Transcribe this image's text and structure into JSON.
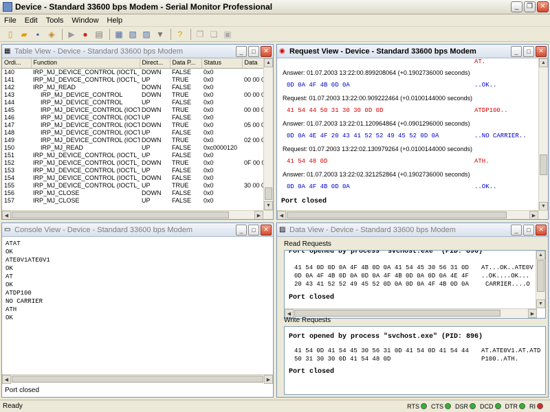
{
  "window": {
    "title": "Device - Standard 33600 bps Modem - Serial Monitor Professional"
  },
  "menu": [
    "File",
    "Edit",
    "Tools",
    "Window",
    "Help"
  ],
  "table_view": {
    "title": "Table View - Device - Standard 33600 bps Modem",
    "columns": [
      "Ordi...",
      "Function",
      "Direct...",
      "Data P...",
      "Status",
      "Data"
    ],
    "rows": [
      [
        "140",
        "IRP_MJ_DEVICE_CONTROL (IOCTL_...",
        "DOWN",
        "FALSE",
        "0x0",
        ""
      ],
      [
        "141",
        "IRP_MJ_DEVICE_CONTROL (IOCTL_...",
        "UP",
        "TRUE",
        "0x0",
        "00 00 0"
      ],
      [
        "142",
        "IRP_MJ_READ",
        "DOWN",
        "FALSE",
        "0x0",
        ""
      ],
      [
        "143",
        "IRP_MJ_DEVICE_CONTROL",
        "DOWN",
        "TRUE",
        "0x0",
        "00 00 0"
      ],
      [
        "144",
        "IRP_MJ_DEVICE_CONTROL",
        "UP",
        "FALSE",
        "0x0",
        ""
      ],
      [
        "145",
        "IRP_MJ_DEVICE_CONTROL (IOCT...",
        "DOWN",
        "TRUE",
        "0x0",
        "00 00 0"
      ],
      [
        "146",
        "IRP_MJ_DEVICE_CONTROL (IOCTL_...",
        "UP",
        "FALSE",
        "0x0",
        ""
      ],
      [
        "147",
        "IRP_MJ_DEVICE_CONTROL (IOCT...",
        "DOWN",
        "TRUE",
        "0x0",
        "05 00 0"
      ],
      [
        "148",
        "IRP_MJ_DEVICE_CONTROL (IOCTL_...",
        "UP",
        "FALSE",
        "0x0",
        ""
      ],
      [
        "149",
        "IRP_MJ_DEVICE_CONTROL (IOCT...",
        "DOWN",
        "TRUE",
        "0x0",
        "02 00 0"
      ],
      [
        "150",
        "IRP_MJ_READ",
        "UP",
        "FALSE",
        "0xc0000120",
        ""
      ],
      [
        "151",
        "IRP_MJ_DEVICE_CONTROL (IOCTL_...",
        "UP",
        "FALSE",
        "0x0",
        ""
      ],
      [
        "152",
        "IRP_MJ_DEVICE_CONTROL (IOCTL_...",
        "DOWN",
        "TRUE",
        "0x0",
        "0F 00 0"
      ],
      [
        "153",
        "IRP_MJ_DEVICE_CONTROL (IOCTL_...",
        "UP",
        "FALSE",
        "0x0",
        ""
      ],
      [
        "154",
        "IRP_MJ_DEVICE_CONTROL (IOCTL_...",
        "DOWN",
        "FALSE",
        "0x0",
        ""
      ],
      [
        "155",
        "IRP_MJ_DEVICE_CONTROL (IOCTL_...",
        "UP",
        "TRUE",
        "0x0",
        "30 00 0"
      ],
      [
        "156",
        "IRP_MJ_CLOSE",
        "DOWN",
        "FALSE",
        "0x0",
        ""
      ],
      [
        "157",
        "IRP_MJ_CLOSE",
        "UP",
        "FALSE",
        "0x0",
        ""
      ]
    ]
  },
  "request_view": {
    "title": "Request View - Device - Standard 33600 bps Modem",
    "top_ascii": "AT.",
    "entries": [
      {
        "header": "Answer: 01.07.2003 13:22:00.899208064 (+0.1902736000 seconds)",
        "hex": "0D 0A 4F 4B 0D 0A",
        "ascii": "..OK..",
        "kind": "answer"
      },
      {
        "header": "Request: 01.07.2003 13:22:00.909222464 (+0.0100144000 seconds)",
        "hex": "41 54 44 50 31 30 30 0D 0D",
        "ascii": "ATDP100..",
        "kind": "request"
      },
      {
        "header": "Answer: 01.07.2003 13:22:01.120964864 (+0.0901296000 seconds)",
        "hex": "0D 0A 4E 4F 20 43 41 52 52 49 45 52 0D 0A",
        "ascii": "..NO CARRIER..",
        "kind": "answer"
      },
      {
        "header": "Request: 01.07.2003 13:22:02.130979264 (+0.0100144000 seconds)",
        "hex": "41 54 48 0D",
        "ascii": "ATH.",
        "kind": "request"
      },
      {
        "header": "Answer: 01.07.2003 13:22:02.321252864 (+0.1902736000 seconds)",
        "hex": "0D 0A 4F 4B 0D 0A",
        "ascii": "..OK..",
        "kind": "answer"
      }
    ],
    "footer": "Port closed"
  },
  "console_view": {
    "title": "Console View - Device - Standard 33600 bps Modem",
    "lines": [
      "ATAT",
      "OK",
      "ATE0V1ATE0V1",
      "OK",
      "AT",
      "OK",
      "ATDP100",
      "NO CARRIER",
      "ATH",
      "OK"
    ],
    "status": "Port closed"
  },
  "data_view": {
    "title": "Data View - Device - Standard 33600 bps Modem",
    "read": {
      "label": "Read Requests",
      "heading": "Port opened by process \"svchost.exe\" (PID: 896)",
      "hex_lines": [
        "41 54 0D 0D 0A 4F 4B 0D 0A 41 54 45 30 56 31 0D",
        "0D 0A 4F 4B 0D 0A 0D 0A 4F 4B 0D 0A 0D 0A 4E 4F",
        "20 43 41 52 52 49 45 52 0D 0A 0D 0A 4F 4B 0D 0A"
      ],
      "ascii_lines": [
        "AT...OK..ATE0V",
        "..OK....OK...",
        "CARRIER....O"
      ],
      "footer": "Port closed"
    },
    "write": {
      "label": "Write Requests",
      "heading": "Port opened by process \"svchost.exe\" (PID: 896)",
      "hex_lines": [
        "41 54 0D 41 54 45 30 56 31 0D 41 54 0D 41 54 44",
        "50 31 30 30 0D 41 54 48 0D"
      ],
      "ascii_lines": [
        "AT.ATE0V1.AT.ATD",
        "P100..ATH."
      ],
      "footer": "Port closed"
    }
  },
  "status": {
    "text": "Ready",
    "indicators": [
      {
        "label": "RTS",
        "color": "#2fb52f"
      },
      {
        "label": "CTS",
        "color": "#2fb52f"
      },
      {
        "label": "DSR",
        "color": "#2fb52f"
      },
      {
        "label": "DCD",
        "color": "#2fb52f"
      },
      {
        "label": "DTR",
        "color": "#2fb52f"
      },
      {
        "label": "RI",
        "color": "#d42a2a"
      }
    ]
  },
  "colors": {
    "request_hex": "#d40000",
    "answer_hex": "#0000c8"
  }
}
